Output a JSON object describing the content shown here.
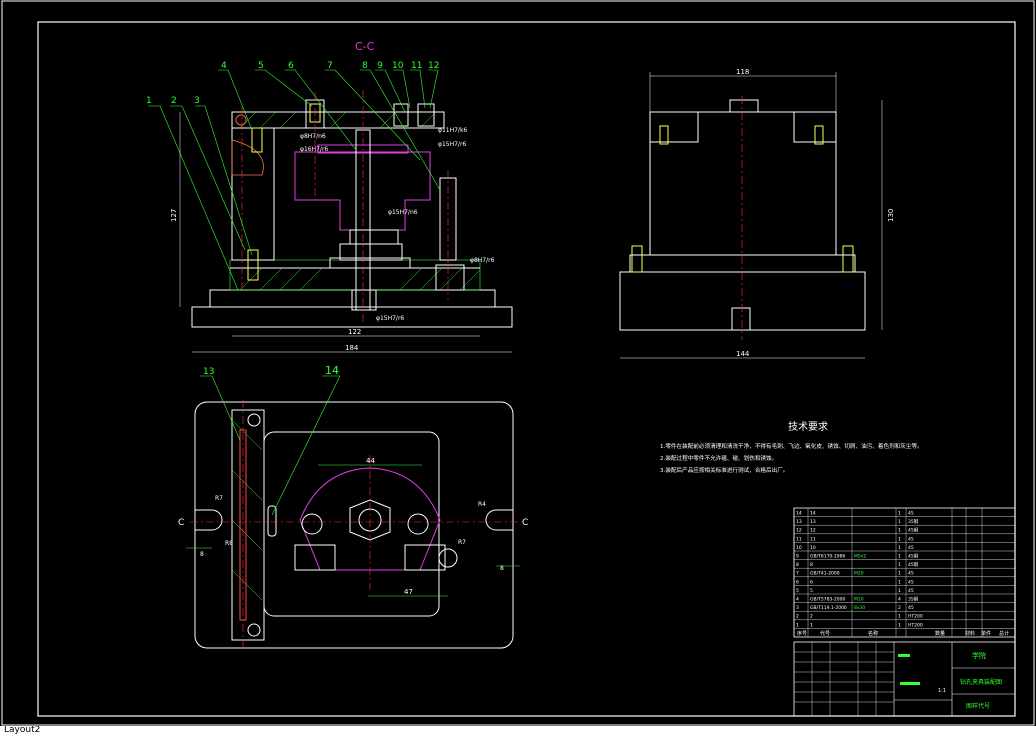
{
  "section_title": "C-C",
  "part_labels": [
    "1",
    "2",
    "3",
    "4",
    "5",
    "6",
    "7",
    "8",
    "9",
    "10",
    "11",
    "12"
  ],
  "plan_labels": [
    "13",
    "14"
  ],
  "fits": {
    "f1": "φ11H7/k6",
    "f2": "φ15H7/r6",
    "f3": "φ8H7/n6",
    "f4": "φ16H7/r6",
    "f5": "φ15H7/n6",
    "f6": "φ8H7/r6",
    "f7": "φ15H7/r6",
    "f8": "φ16H7/r6"
  },
  "dims": {
    "front_height": "127",
    "front_inner": "122",
    "front_width": "184",
    "side_top": "118",
    "side_height": "130",
    "side_width": "144",
    "plan_top": "44",
    "plan_47": "47",
    "plan_r7": "R7",
    "plan_r8": "R8",
    "plan_r4": "R4",
    "plan_r7b": "R7",
    "plan_8": "8",
    "plan_8b": "8"
  },
  "section_marks": {
    "left": "C",
    "right": "C"
  },
  "tech": {
    "title": "技术要求",
    "items": [
      "1.零件在装配前必须清理和清洗干净，不得有毛刺、飞边、氧化皮、锈蚀、切屑、油污、着色剂和灰尘等。",
      "2.装配过程中零件不允许磕、碰、划伤和锈蚀。",
      "3.装配后产品应按相关标准进行测试，合格后出厂。"
    ]
  },
  "bom": {
    "rows": [
      [
        "14",
        "14",
        "",
        "1",
        "45"
      ],
      [
        "13",
        "13",
        "",
        "1",
        "35钢"
      ],
      [
        "12",
        "12",
        "",
        "1",
        "45钢"
      ],
      [
        "11",
        "11",
        "",
        "1",
        "45"
      ],
      [
        "10",
        "10",
        "",
        "1",
        "45"
      ],
      [
        "9",
        "GB/T6170-1986",
        "M5x2",
        "1",
        "45钢"
      ],
      [
        "8",
        "8",
        "",
        "1",
        "45钢"
      ],
      [
        "7",
        "GB/T41-2000",
        "M20",
        "1",
        "45"
      ],
      [
        "6",
        "6",
        "",
        "1",
        "45"
      ],
      [
        "5",
        "5",
        "",
        "1",
        "45"
      ],
      [
        "4",
        "GB/T5783-2000",
        "M10",
        "4",
        "35钢"
      ],
      [
        "3",
        "GB/T119.1-2000",
        "8x30",
        "2",
        "45"
      ],
      [
        "2",
        "2",
        "",
        "1",
        "HT200"
      ],
      [
        "1",
        "1",
        "",
        "1",
        "HT200"
      ]
    ],
    "header": [
      "序号",
      "代号",
      "名称",
      "数量",
      "材料",
      "单件",
      "总计",
      "备注"
    ],
    "title_block": {
      "school": "学院",
      "drawing_name": "钻孔夹具装配图",
      "drawing_no": "图样代号",
      "scale": "1:1"
    }
  },
  "layout_tab": "Layout2"
}
